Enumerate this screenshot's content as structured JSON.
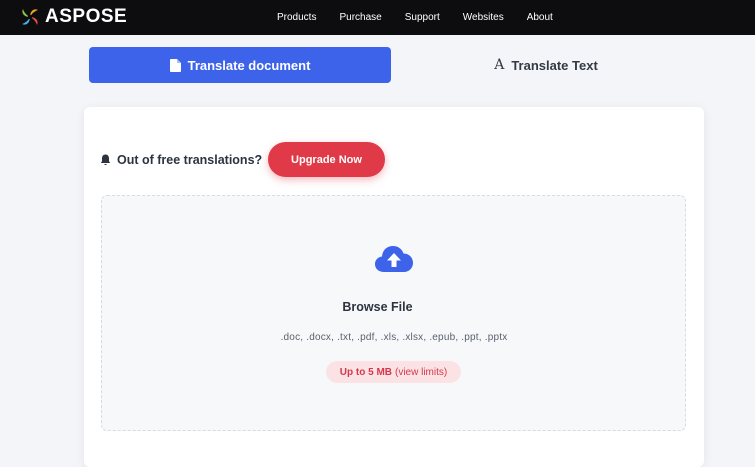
{
  "header": {
    "logo_text": "ASPOSE",
    "nav": [
      "Products",
      "Purchase",
      "Support",
      "Websites",
      "About"
    ]
  },
  "tabs": {
    "document": "Translate document",
    "text": "Translate Text"
  },
  "notice": {
    "message": "Out of free translations?",
    "upgrade_label": "Upgrade Now"
  },
  "upload": {
    "browse_label": "Browse File",
    "formats": ".doc, .docx, .txt, .pdf, .xls, .xlsx, .epub, .ppt, .pptx",
    "size_limit": "Up to 5 MB",
    "limits_link": "(view limits)"
  },
  "icons": {
    "logo": "aspose-swirl-icon",
    "document": "file-icon",
    "text": "font-a-icon",
    "bell": "bell-icon",
    "upload": "cloud-upload-icon"
  },
  "colors": {
    "navbar": "#0d0d0f",
    "primary": "#3d63ea",
    "upgrade": "#e03a48",
    "badge_bg": "#fbe3e5",
    "badge_text": "#d6374a"
  }
}
